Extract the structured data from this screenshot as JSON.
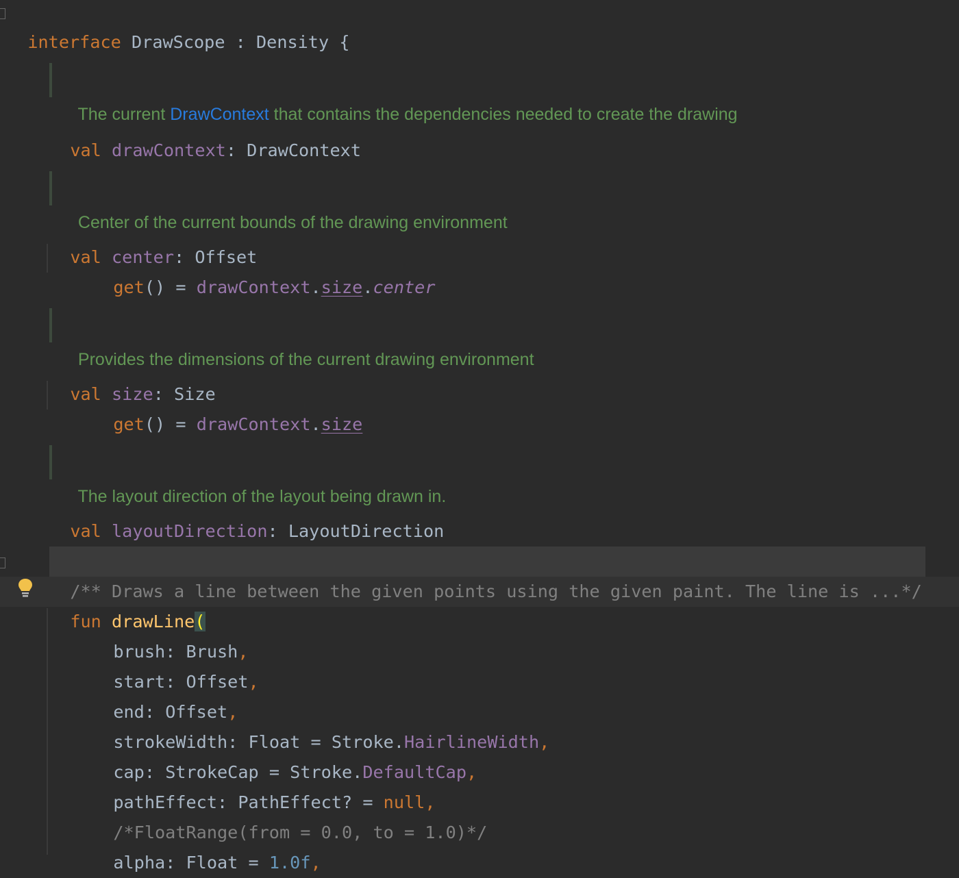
{
  "header": {
    "kw_interface": "interface",
    "name": "DrawScope",
    "sep": " : ",
    "parent": "Density",
    "brace": "{"
  },
  "docs": {
    "d1_pre": "The current ",
    "d1_link": "DrawContext",
    "d1_post": " that contains the dependencies needed to create the drawing",
    "d2": "Center of the current bounds of the drawing environment",
    "d3": "Provides the dimensions of the current drawing environment",
    "d4": "The layout direction of the layout being drawn in."
  },
  "code": {
    "val": "val",
    "fun": "fun",
    "get": "get",
    "parens": "()",
    "eq": " = ",
    "colon": ": ",
    "comma": ",",
    "dot": ".",
    "drawContext": "drawContext",
    "DrawContext": "DrawContext",
    "center": "center",
    "Offset": "Offset",
    "size": "size",
    "Size": "Size",
    "layoutDirection": "layoutDirection",
    "LayoutDirection": "LayoutDirection",
    "collapsed_comment": "/** Draws a line between the given points using the given paint. The line is ...*/",
    "drawLine": "drawLine",
    "open_paren": "(",
    "p_brush": "brush",
    "t_Brush": "Brush",
    "p_start": "start",
    "p_end": "end",
    "p_strokeWidth": "strokeWidth",
    "t_Float": "Float",
    "Stroke": "Stroke",
    "HairlineWidth": "HairlineWidth",
    "p_cap": "cap",
    "t_StrokeCap": "StrokeCap",
    "DefaultCap": "DefaultCap",
    "p_pathEffect": "pathEffect",
    "t_PathEffect": "PathEffect?",
    "null": "null",
    "float_range_comment": "/*FloatRange(from = 0.0, to = 1.0)*/",
    "p_alpha": "alpha",
    "alpha_val": "1.0f"
  },
  "colors": {
    "background": "#2b2b2b",
    "keyword": "#cc7832",
    "property": "#9876aa",
    "function": "#ffc66d",
    "number": "#6897bb",
    "doc_text": "#629755",
    "doc_link": "#287bde",
    "comment": "#808080"
  },
  "icons": {
    "intention": "lightbulb-icon"
  }
}
